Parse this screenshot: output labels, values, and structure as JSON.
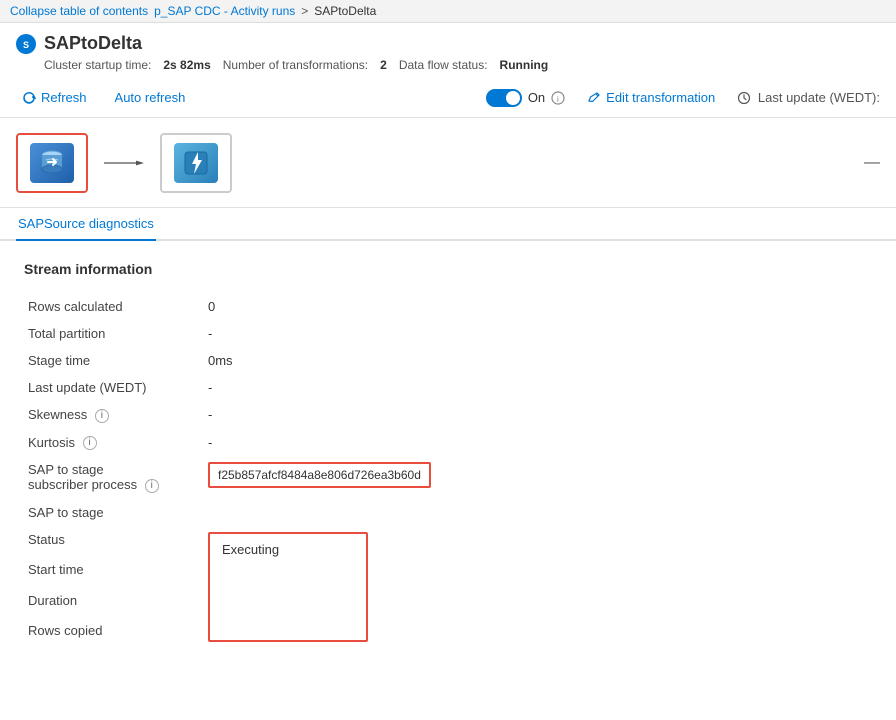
{
  "breadcrumb": {
    "collapse_label": "Collapse table of contents",
    "parent1": "p_SAP CDC - Activity runs",
    "separator": ">",
    "current": "SAPtoDelta"
  },
  "page": {
    "icon": "●",
    "title": "SAPtoDelta",
    "cluster_startup_label": "Cluster startup time:",
    "cluster_startup_value": "2s 82ms",
    "num_transform_label": "Number of transformations:",
    "num_transform_value": "2",
    "data_flow_label": "Data flow status:",
    "data_flow_value": "Running"
  },
  "toolbar": {
    "refresh_label": "Refresh",
    "auto_refresh_label": "Auto refresh",
    "toggle_state": "On",
    "edit_transformation_label": "Edit transformation",
    "last_update_label": "Last update (WEDT):"
  },
  "flow": {
    "node1_icon": "↺",
    "node2_icon": "⚡",
    "minimize_icon": "—"
  },
  "tabs": {
    "active_tab": "SAPSource diagnostics"
  },
  "stream_info": {
    "section_title": "Stream information",
    "rows": [
      {
        "label": "Rows calculated",
        "value": "0",
        "icon": false
      },
      {
        "label": "Total partition",
        "value": "-",
        "icon": false
      },
      {
        "label": "Stage time",
        "value": "0ms",
        "icon": false
      },
      {
        "label": "Last update (WEDT)",
        "value": "-",
        "icon": false
      },
      {
        "label": "Skewness",
        "value": "-",
        "icon": true
      },
      {
        "label": "Kurtosis",
        "value": "-",
        "icon": true
      },
      {
        "label": "SAP to stage\nsubscriber process",
        "value": "f25b857afcf8484a8e806d726ea3b60d",
        "icon": true,
        "highlight": true
      }
    ]
  },
  "sap_to_stage": {
    "section_label": "SAP to stage",
    "status_label": "Status",
    "status_value": "Executing",
    "start_time_label": "Start time",
    "duration_label": "Duration",
    "rows_copied_label": "Rows copied"
  }
}
